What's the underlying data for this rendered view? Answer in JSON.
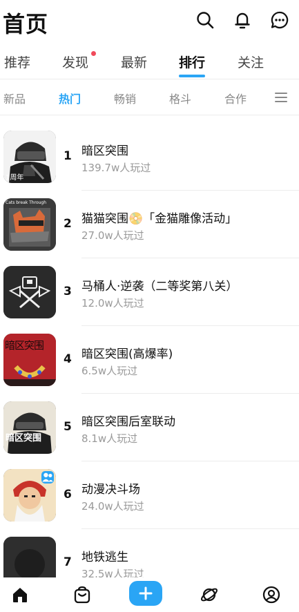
{
  "header": {
    "title": "首页",
    "icons": [
      "search-icon",
      "bell-icon",
      "chat-icon"
    ]
  },
  "tabs": [
    {
      "label": "推荐",
      "active": false
    },
    {
      "label": "发现",
      "active": false,
      "badge": true
    },
    {
      "label": "最新",
      "active": false
    },
    {
      "label": "排行",
      "active": true
    },
    {
      "label": "关注",
      "active": false
    }
  ],
  "subtabs": [
    {
      "label": "新品",
      "active": false
    },
    {
      "label": "热门",
      "active": true
    },
    {
      "label": "畅销",
      "active": false
    },
    {
      "label": "格斗",
      "active": false
    },
    {
      "label": "合作",
      "active": false
    }
  ],
  "menu_icon": "menu-icon",
  "games": [
    {
      "rank": "1",
      "name": "暗区突围",
      "plays": "139.7w人玩过",
      "thumb_text": "1周年"
    },
    {
      "rank": "2",
      "name": "猫猫突围📀「金猫雕像活动」",
      "plays": "27.0w人玩过",
      "thumb_text": "Cats break Through"
    },
    {
      "rank": "3",
      "name": "马桶人·逆袭（二等奖第八关）",
      "plays": "12.0w人玩过",
      "thumb_text": ""
    },
    {
      "rank": "4",
      "name": "暗区突围(高爆率)",
      "plays": "6.5w人玩过",
      "thumb_text": "暗区突围"
    },
    {
      "rank": "5",
      "name": "暗区突围后室联动",
      "plays": "8.1w人玩过",
      "thumb_text": "暗区突围"
    },
    {
      "rank": "6",
      "name": "动漫决斗场",
      "plays": "24.0w人玩过",
      "thumb_text": ""
    },
    {
      "rank": "7",
      "name": "地铁逃生",
      "plays": "32.5w人玩过",
      "thumb_text": ""
    }
  ],
  "bottom_nav": [
    {
      "icon": "home-icon",
      "active": true
    },
    {
      "icon": "bag-icon",
      "active": false
    },
    {
      "icon": "add-icon",
      "active": false
    },
    {
      "icon": "planet-icon",
      "active": false
    },
    {
      "icon": "profile-icon",
      "active": false
    }
  ],
  "colors": {
    "accent": "#2aa5f5",
    "badge": "#f04a5a",
    "muted": "#999999"
  }
}
